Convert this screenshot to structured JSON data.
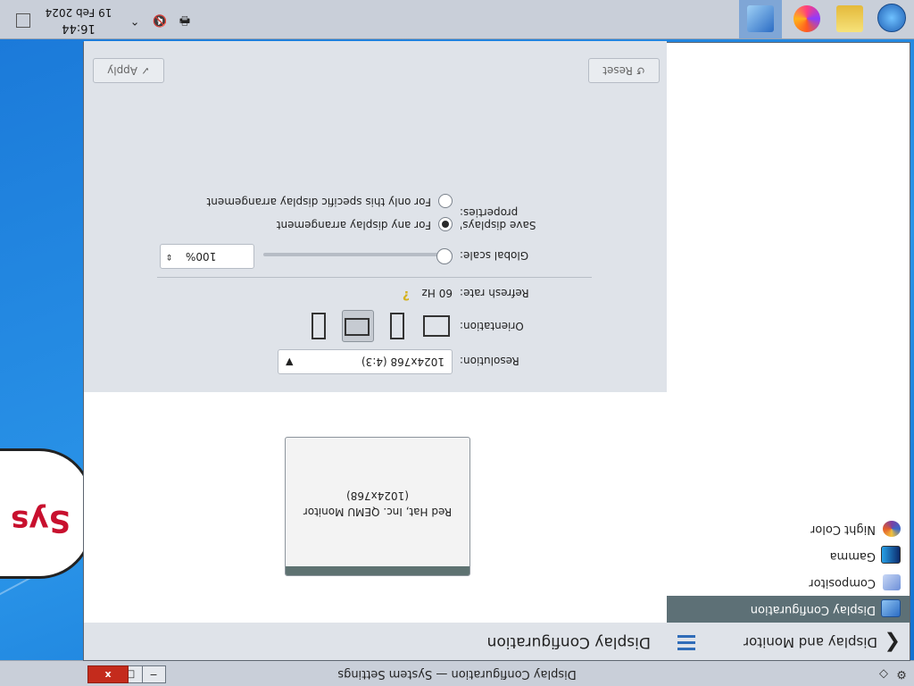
{
  "titlebar": {
    "title": "Display Configuration — System Settings",
    "close_glyph": "x",
    "maximize_glyph": "□",
    "minimize_glyph": "−",
    "pin_glyph": "◇"
  },
  "sidebar": {
    "back_glyph": "❮",
    "title": "Display and Monitor",
    "items": [
      {
        "label": "Display Configuration",
        "icon": "monitor-icon",
        "selected": true
      },
      {
        "label": "Compositor",
        "icon": "compositor-icon",
        "selected": false
      },
      {
        "label": "Gamma",
        "icon": "gamma-icon",
        "selected": false
      },
      {
        "label": "Night Color",
        "icon": "night-color-icon",
        "selected": false
      }
    ]
  },
  "main": {
    "title": "Display Configuration",
    "monitor": {
      "name": "Red Hat, Inc. QEMU Monitor",
      "resolution": "(1024x768)"
    },
    "resolution_label": "Resolution:",
    "resolution_value": "1024x768 (4:3)",
    "orientation_label": "Orientation:",
    "orientation_options": [
      "rotate-90-icon",
      "landscape-icon",
      "rotate-270-icon",
      "portrait-flipped-icon"
    ],
    "orientation_selected": 1,
    "refresh_label": "Refresh rate:",
    "refresh_value": "60 Hz",
    "global_scale_label": "Global scale:",
    "global_scale_value": "100%",
    "save_label": "Save displays' properties:",
    "save_option_any": "For any display arrangement",
    "save_option_specific": "For only this specific display arrangement",
    "save_selected": "any",
    "reset_label": "Reset",
    "apply_label": "Apply"
  },
  "taskbar": {
    "apps": [
      "start-icon",
      "file-manager-icon",
      "browser-icon",
      "system-settings-icon"
    ],
    "active_app": "system-settings-icon",
    "time": "16:44",
    "date": "19 Feb 2024"
  },
  "colors": {
    "selection": "#5d7076",
    "accent": "#2f6cb8",
    "titlebar": "#c9cfd9"
  }
}
